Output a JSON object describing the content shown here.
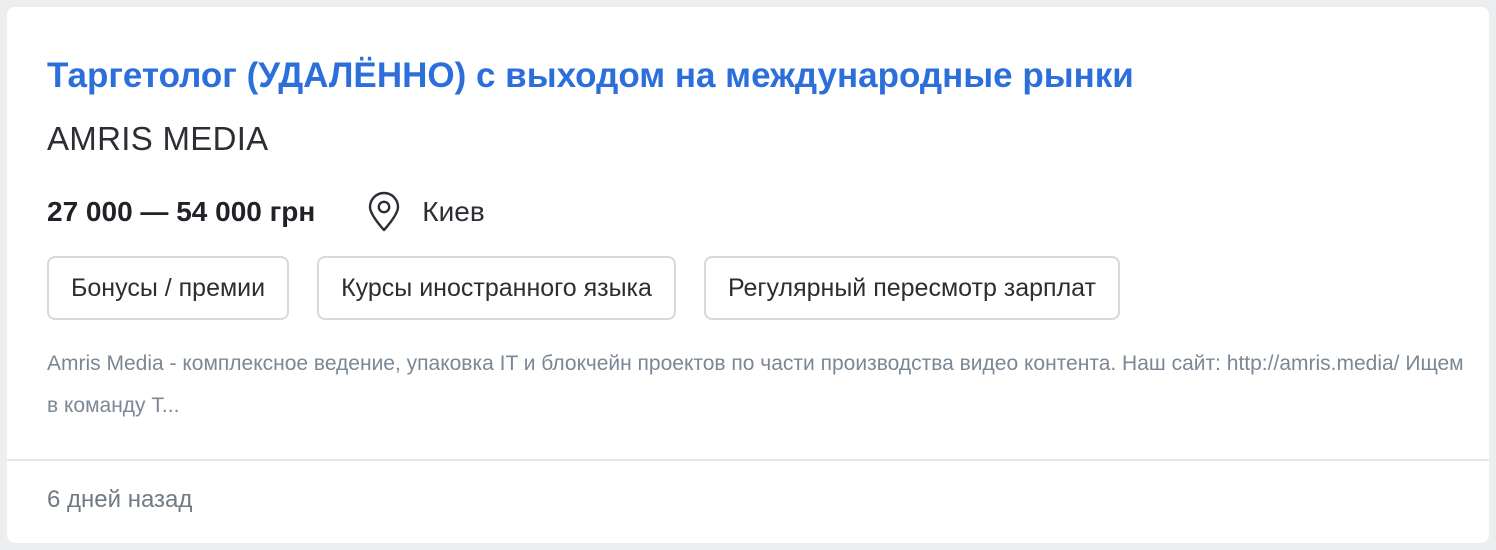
{
  "vacancy": {
    "title": "Таргетолог (УДАЛЁННО) с выходом на международные рынки",
    "company": "AMRIS MEDIA",
    "salary": "27 000 — 54 000 грн",
    "location": "Киев",
    "location_icon": "map-pin-icon",
    "tags": [
      "Бонусы / премии",
      "Курсы иностранного языка",
      "Регулярный пересмотр зарплат"
    ],
    "description": "Amris Media - комплексное ведение, упаковка IT и блокчейн проектов по части производства видео контента. Наш сайт: http://amris.media/ Ищем в команду Т...",
    "posted": "6 дней назад"
  },
  "colors": {
    "title": "#2c6fdb",
    "text": "#2b2e33",
    "muted": "#7a8896",
    "border": "#d6dadf",
    "background": "#eceef0"
  }
}
